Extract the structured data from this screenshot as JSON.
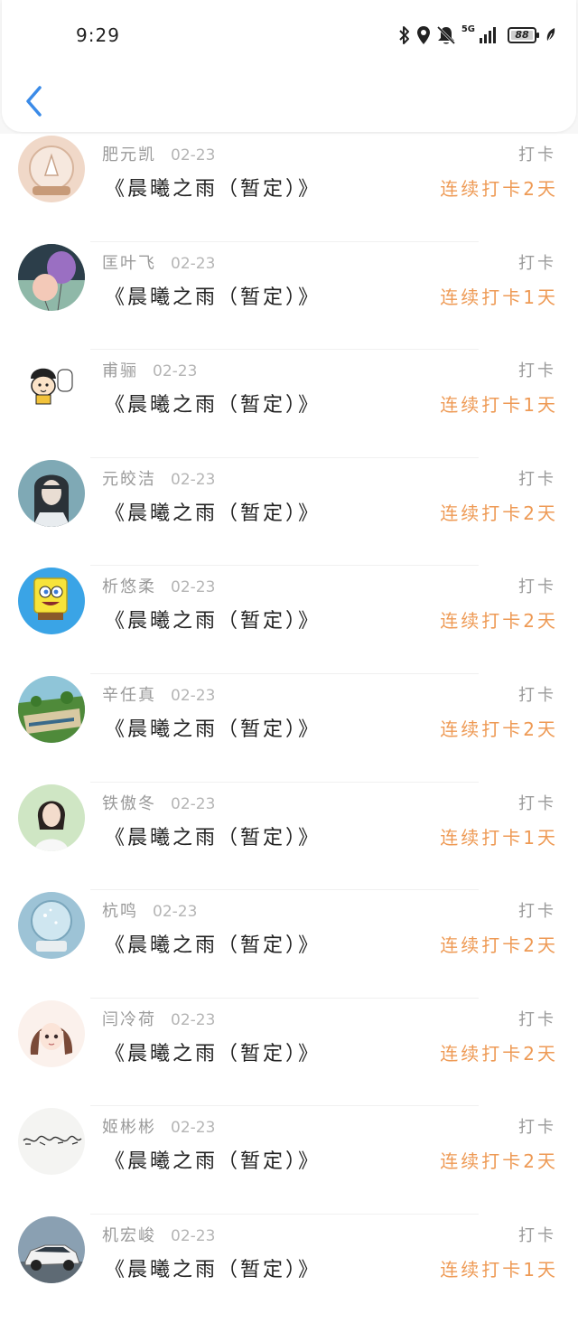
{
  "status_bar": {
    "time": "9:29",
    "network": "5G",
    "battery": "88",
    "icons": [
      "bluetooth-icon",
      "location-icon",
      "mute-icon",
      "signal-icon",
      "battery-icon",
      "leaf-icon"
    ]
  },
  "header": {
    "back_icon": "chevron-left-icon",
    "accent_color": "#3b8be8"
  },
  "colors": {
    "streak": "#ee9a55",
    "name": "#9a9a9a"
  },
  "items": [
    {
      "name": "肥元凯",
      "date": "02-23",
      "title": "《晨曦之雨（暂定）》",
      "badge": "打卡",
      "streak": "连续打卡2天",
      "avatar": "snow-globe-avatar"
    },
    {
      "name": "匡叶飞",
      "date": "02-23",
      "title": "《晨曦之雨（暂定）》",
      "badge": "打卡",
      "streak": "连续打卡1天",
      "avatar": "balloons-avatar"
    },
    {
      "name": "甫骊",
      "date": "02-23",
      "title": "《晨曦之雨（暂定）》",
      "badge": "打卡",
      "streak": "连续打卡1天",
      "avatar": "cartoon-girl-avatar"
    },
    {
      "name": "元皎洁",
      "date": "02-23",
      "title": "《晨曦之雨（暂定）》",
      "badge": "打卡",
      "streak": "连续打卡2天",
      "avatar": "anime-character-avatar"
    },
    {
      "name": "析悠柔",
      "date": "02-23",
      "title": "《晨曦之雨（暂定）》",
      "badge": "打卡",
      "streak": "连续打卡2天",
      "avatar": "spongebob-avatar"
    },
    {
      "name": "辛任真",
      "date": "02-23",
      "title": "《晨曦之雨（暂定）》",
      "badge": "打卡",
      "streak": "连续打卡2天",
      "avatar": "landscape-avatar"
    },
    {
      "name": "铁傲冬",
      "date": "02-23",
      "title": "《晨曦之雨（暂定）》",
      "badge": "打卡",
      "streak": "连续打卡1天",
      "avatar": "girl-photo-avatar"
    },
    {
      "name": "杭鸣",
      "date": "02-23",
      "title": "《晨曦之雨（暂定）》",
      "badge": "打卡",
      "streak": "连续打卡2天",
      "avatar": "crystal-ball-avatar"
    },
    {
      "name": "闫冷荷",
      "date": "02-23",
      "title": "《晨曦之雨（暂定）》",
      "badge": "打卡",
      "streak": "连续打卡2天",
      "avatar": "anime-girl-avatar"
    },
    {
      "name": "姬彬彬",
      "date": "02-23",
      "title": "《晨曦之雨（暂定）》",
      "badge": "打卡",
      "streak": "连续打卡2天",
      "avatar": "calligraphy-avatar"
    },
    {
      "name": "机宏峻",
      "date": "02-23",
      "title": "《晨曦之雨（暂定）》",
      "badge": "打卡",
      "streak": "连续打卡1天",
      "avatar": "car-avatar"
    }
  ]
}
